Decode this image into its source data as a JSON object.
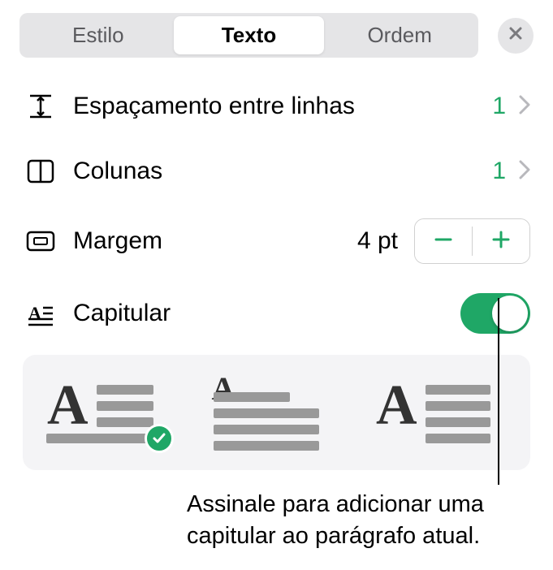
{
  "tabs": {
    "style": "Estilo",
    "text": "Texto",
    "order": "Ordem",
    "active": "text"
  },
  "rows": {
    "lineSpacing": {
      "label": "Espaçamento entre linhas",
      "value": "1"
    },
    "columns": {
      "label": "Colunas",
      "value": "1"
    },
    "margin": {
      "label": "Margem",
      "value": "4 pt"
    },
    "dropcap": {
      "label": "Capitular",
      "on": true
    }
  },
  "dropcapOptions": {
    "selectedIndex": 0
  },
  "annotation": {
    "text1": "Assinale para adicionar uma",
    "text2": "capitular ao parágrafo atual."
  },
  "colors": {
    "accent": "#1fa766",
    "segmentBg": "#e5e5e7",
    "panelBg": "#f4f4f6"
  }
}
